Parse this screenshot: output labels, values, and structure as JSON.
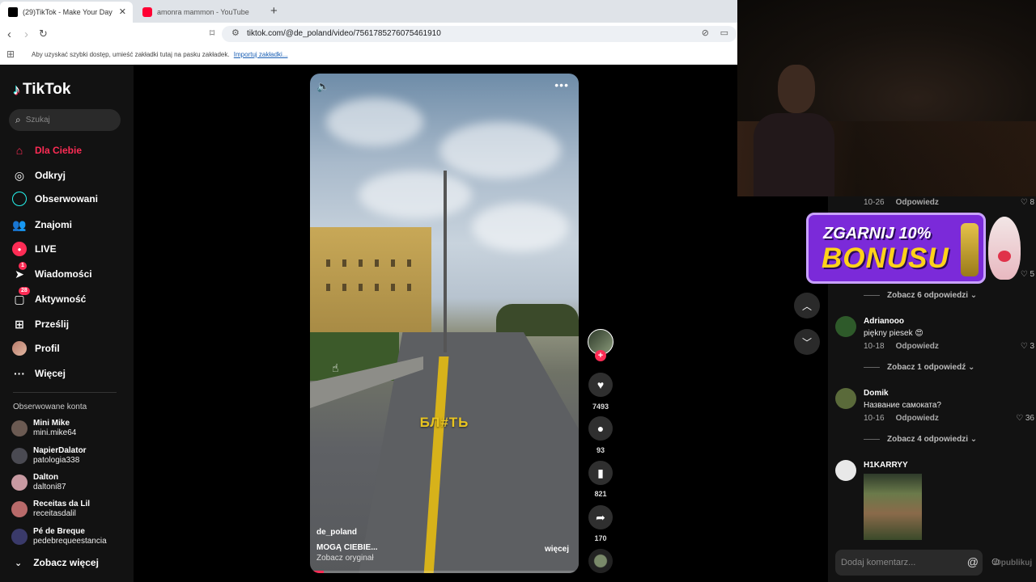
{
  "browser": {
    "tabs": [
      {
        "title": "(29)TikTok - Make Your Day",
        "close": "✕"
      },
      {
        "title": "amonra mammon - YouTube"
      }
    ],
    "new_tab": "+",
    "url": "tiktok.com/@de_poland/video/7561785276075461910",
    "bookmarks_hint": "Aby uzyskać szybki dostęp, umieść zakładki tutaj na pasku zakładek.",
    "bookmarks_import": "Importuj zakładki..."
  },
  "sidebar": {
    "logo": "TikTok",
    "search_placeholder": "Szukaj",
    "nav": [
      {
        "label": "Dla Ciebie",
        "icon": "home-icon",
        "active": true
      },
      {
        "label": "Odkryj",
        "icon": "compass-icon"
      },
      {
        "label": "Obserwowani",
        "icon": "following-icon"
      },
      {
        "label": "Znajomi",
        "icon": "friends-icon"
      },
      {
        "label": "LIVE",
        "icon": "live-icon"
      },
      {
        "label": "Wiadomości",
        "icon": "messages-icon",
        "badge": "1"
      },
      {
        "label": "Aktywność",
        "icon": "activity-icon",
        "badge": "28"
      },
      {
        "label": "Prześlij",
        "icon": "upload-icon"
      },
      {
        "label": "Profil",
        "icon": "profile-icon"
      },
      {
        "label": "Więcej",
        "icon": "more-icon"
      }
    ],
    "following_title": "Obserwowane konta",
    "following": [
      {
        "name": "Mini Mike",
        "handle": "mini.mike64",
        "color": "#6b5a52"
      },
      {
        "name": "NapierDalator",
        "handle": "patologia338",
        "color": "#4a4a52"
      },
      {
        "name": "Dalton",
        "handle": "daltoni87",
        "color": "#c89aa2"
      },
      {
        "name": "Receitas da Lil",
        "handle": "receitasdalil",
        "color": "#b86a6a"
      },
      {
        "name": "Pé de Breque",
        "handle": "pedebrequeestancia",
        "color": "#3a3a6a"
      }
    ],
    "see_more": "Zobacz więcej"
  },
  "video": {
    "overlay_text": "БЛ#ТЬ",
    "author": "de_poland",
    "description": "MOGĄ CIEBIE...",
    "sound": "Zobacz oryginał",
    "more": "więcej",
    "progress": 0.05
  },
  "actions": {
    "likes": "7493",
    "comments": "93",
    "saves": "821",
    "shares": "170"
  },
  "banner": {
    "line1": "ZGARNIJ 10%",
    "line2": "BONUSU"
  },
  "comments": {
    "items": [
      {
        "date": "10-26",
        "reply": "Odpowiedz",
        "likes": "8"
      },
      {
        "date": "",
        "reply": "",
        "likes": "5",
        "view_replies": "Zobacz 6 odpowiedzi"
      },
      {
        "user": "Adrianooo",
        "text": "piękny piesek 😍",
        "date": "10-18",
        "reply": "Odpowiedz",
        "likes": "3",
        "view_replies": "Zobacz 1 odpowiedź"
      },
      {
        "user": "Domik",
        "text": "Название самоката?",
        "date": "10-16",
        "reply": "Odpowiedz",
        "likes": "36",
        "view_replies": "Zobacz 4 odpowiedzi"
      },
      {
        "user": "H1KARRYY"
      }
    ],
    "input_placeholder": "Dodaj komentarz...",
    "publish": "Opublikuj"
  }
}
